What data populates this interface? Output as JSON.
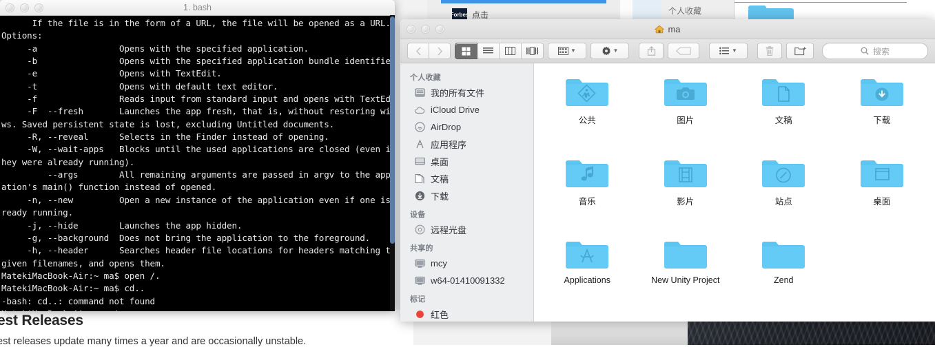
{
  "terminal": {
    "title": "1. bash",
    "traffic_lights": [
      "close",
      "minimize",
      "zoom"
    ],
    "output": "      If the file is in the form of a URL, the file will be opened as a URL.\nOptions:\n     -a                Opens with the specified application.\n     -b                Opens with the specified application bundle identifier.\n     -e                Opens with TextEdit.\n     -t                Opens with default text editor.\n     -f                Reads input from standard input and opens with TextEdit.\n     -F  --fresh       Launches the app fresh, that is, without restoring windo\nws. Saved persistent state is lost, excluding Untitled documents.\n     -R, --reveal      Selects in the Finder instead of opening.\n     -W, --wait-apps   Blocks until the used applications are closed (even if t\nhey were already running).\n         --args        All remaining arguments are passed in argv to the applic\nation's main() function instead of opened.\n     -n, --new         Open a new instance of the application even if one is al\nready running.\n     -j, --hide        Launches the app hidden.\n     -g, --background  Does not bring the application to the foreground.\n     -h, --header      Searches header file locations for headers matching the\ngiven filenames, and opens them.\nMatekiMacBook-Air:~ ma$ open /.\nMatekiMacBook-Air:~ ma$ cd..\n-bash: cd..: command not found\nMatekiMacBook-Air:~ ma$ open .\nMatekiMacBook-Air:~ ma$ "
  },
  "finder": {
    "title": "ma",
    "title_icon": "home-icon",
    "toolbar": {
      "back_icon": "chevron-left-icon",
      "forward_icon": "chevron-right-icon",
      "view_icon_grid": "grid-view-icon",
      "view_list": "list-view-icon",
      "view_columns": "column-view-icon",
      "view_coverflow": "coverflow-view-icon",
      "arrange_icon": "arrange-icon",
      "action_icon": "gear-icon",
      "share_icon": "share-icon",
      "tag_icon": "tag-icon",
      "sort_icon": "sort-list-icon",
      "delete_icon": "trash-icon",
      "new_folder_icon": "new-folder-icon",
      "search_icon": "search-icon",
      "search_placeholder": "搜索",
      "dropdown_icon": "chevron-down-icon"
    },
    "sidebar": {
      "groups": [
        {
          "label": "个人收藏",
          "items": [
            {
              "label": "我的所有文件",
              "icon": "all-my-files-icon"
            },
            {
              "label": "iCloud Drive",
              "icon": "cloud-icon"
            },
            {
              "label": "AirDrop",
              "icon": "airdrop-icon"
            },
            {
              "label": "应用程序",
              "icon": "applications-icon"
            },
            {
              "label": "桌面",
              "icon": "desktop-icon"
            },
            {
              "label": "文稿",
              "icon": "documents-icon"
            },
            {
              "label": "下载",
              "icon": "downloads-icon"
            }
          ]
        },
        {
          "label": "设备",
          "items": [
            {
              "label": "远程光盘",
              "icon": "remote-disc-icon"
            }
          ]
        },
        {
          "label": "共享的",
          "items": [
            {
              "label": "mcy",
              "icon": "computer-icon"
            },
            {
              "label": "w64-01410091332",
              "icon": "computer-icon"
            }
          ]
        },
        {
          "label": "标记",
          "items": [
            {
              "label": "红色",
              "icon": "red-tag-icon"
            }
          ]
        }
      ]
    },
    "items": [
      {
        "label": "公共",
        "icon": "public-folder-icon"
      },
      {
        "label": "图片",
        "icon": "pictures-folder-icon"
      },
      {
        "label": "文稿",
        "icon": "documents-folder-icon"
      },
      {
        "label": "下载",
        "icon": "downloads-folder-icon"
      },
      {
        "label": "音乐",
        "icon": "music-folder-icon"
      },
      {
        "label": "影片",
        "icon": "movies-folder-icon"
      },
      {
        "label": "站点",
        "icon": "sites-folder-icon"
      },
      {
        "label": "桌面",
        "icon": "desktop-folder-icon"
      },
      {
        "label": "Applications",
        "icon": "applications-folder-icon"
      },
      {
        "label": "New Unity Project",
        "icon": "plain-folder-icon"
      },
      {
        "label": "Zend",
        "icon": "plain-folder-icon"
      }
    ]
  },
  "background_browser": {
    "favorite_label": "点击",
    "favicon_text": "Forbes"
  },
  "background_finder": {
    "sidebar_title": "个人收藏"
  },
  "background_page": {
    "heading": "est Releases",
    "paragraph": "est releases update many times a year and are occasionally unstable."
  },
  "colors": {
    "folder_blue": "#5cc6f2",
    "terminal_bg": "#000000",
    "accent": "#3d93e8",
    "red_tag": "#e8453c"
  }
}
